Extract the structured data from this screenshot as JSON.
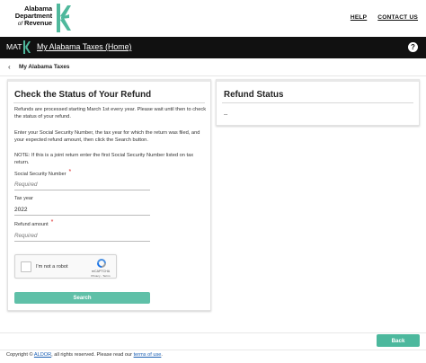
{
  "header": {
    "logo": {
      "line1": "Alabama",
      "line2": "Department",
      "line3_of": "of",
      "line3_rest": "Revenue"
    },
    "links": [
      "HELP",
      "CONTACT US"
    ]
  },
  "navbar": {
    "app_short": "MAT",
    "home_label": "My Alabama Taxes (Home)",
    "help_symbol": "?"
  },
  "breadcrumb": {
    "back_label": "My Alabama Taxes"
  },
  "refund_check": {
    "title": "Check the Status of Your Refund",
    "intro": "Refunds are processed starting March 1st every year. Please wait until then to check the status of your refund.",
    "instructions": "Enter your Social Security Number, the tax year for which the return was filed, and your expected refund amount, then click the Search button.",
    "note": "NOTE: If this is a joint return enter the first Social Security Number listed on tax return.",
    "fields": {
      "ssn": {
        "label": "Social Security Number",
        "placeholder": "Required",
        "value": ""
      },
      "tax_year": {
        "label": "Tax year",
        "value": "2022"
      },
      "refund_amount": {
        "label": "Refund amount",
        "placeholder": "Required",
        "value": ""
      }
    },
    "required_mark": "*",
    "captcha": {
      "label": "I'm not a robot",
      "brand": "reCAPTCHA",
      "terms": "Privacy - Terms"
    },
    "search_label": "Search"
  },
  "refund_status": {
    "title": "Refund Status",
    "value": "--"
  },
  "actions": {
    "back_label": "Back"
  },
  "footer": {
    "prefix": "Copyright ©",
    "org": "ALDOR",
    "middle": ", all rights reserved. Please read our",
    "terms": "terms of use",
    "suffix": "."
  },
  "colors": {
    "accent": "#5fc0a8",
    "navbar": "#111111",
    "required": "#dd2222"
  }
}
